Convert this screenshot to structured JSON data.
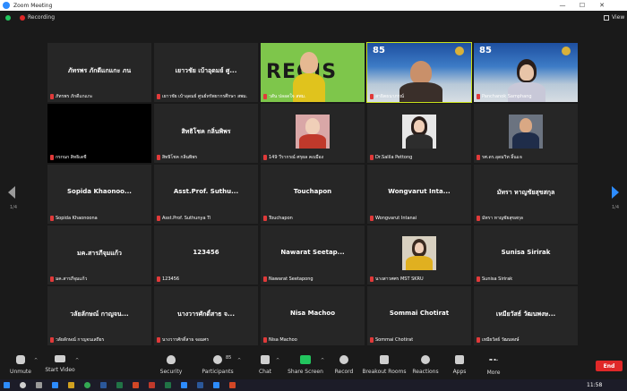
{
  "window": {
    "title": "Zoom Meeting",
    "controls": [
      "—",
      "☐",
      "✕"
    ]
  },
  "status": {
    "recording_label": "Recording",
    "view_label": "View"
  },
  "pages": {
    "left": "1/4",
    "right": "1/4"
  },
  "tiles": [
    {
      "big": "ภัทรพร ภักดีแกแกะ ภน",
      "name": "ภัทรพร ภักดีแกแกะ"
    },
    {
      "big": "เยาวชัย เบ้าอุดมย์ ศู...",
      "name": "เยาวชัย เบ้าอุดมย์ ศูนย์ทรัพยากรศึกษา สพม."
    },
    {
      "big": "",
      "name": "วสัน ปลอดใจ สพม.",
      "video": "regis",
      "video_text": "REGIS"
    },
    {
      "big": "",
      "name": "สาธิตธนาภรณ์",
      "video": "man",
      "video_text": "85"
    },
    {
      "big": "",
      "name": "Panchanok Samphang",
      "video": "woman",
      "video_text": "85"
    },
    {
      "big": "",
      "name": "กรกนก สิทธิเดชี",
      "video": "black"
    },
    {
      "big": "สิทธิโชค กลิ่นพิพร",
      "name": "สิทธิโชค กลิ่นพิพร"
    },
    {
      "big": "",
      "name": "149 วีรากรณ์ ศรุผล คงเมือง",
      "video": "photo"
    },
    {
      "big": "",
      "name": "Dr.Salila Pettong",
      "video": "photo"
    },
    {
      "big": "",
      "name": "รศ.ดร.อุดมวิท อิ้นแจ",
      "video": "photo"
    },
    {
      "big": "Sopida Khaonoo...",
      "name": "Sopida Khaonoona"
    },
    {
      "big": "Asst.Prof. Suthu...",
      "name": "Asst.Prof. Suthunya Ti"
    },
    {
      "big": "Touchapon",
      "name": "Touchapon"
    },
    {
      "big": "Wongvarut Inta...",
      "name": "Wongvarut Intanai"
    },
    {
      "big": "มัทรา หาญชัยสุขสกุล",
      "name": "มัทรา หาญชัยสุขสกุล"
    },
    {
      "big": "มค.สารภีจุมแก้ว",
      "name": "มค.สารภีจุมแก้ว"
    },
    {
      "big": "123456",
      "name": "123456"
    },
    {
      "big": "Nawarat Seetap...",
      "name": "Nawarat Seetapong"
    },
    {
      "big": "",
      "name": "นางสาวศศร MST SKRU",
      "video": "photo"
    },
    {
      "big": "Sunisa Sirirak",
      "name": "Sunisa Sirirak"
    },
    {
      "big": "วลัยลักษณ์ กาญจน...",
      "name": "วลัยลักษณ์ กาญจนเสถียร"
    },
    {
      "big": "นางวารศักดิ์สาธ จ...",
      "name": "นางวารศักดิ์สาธ จอมศร"
    },
    {
      "big": "Nisa Machoo",
      "name": "Nisa Machoo"
    },
    {
      "big": "Sommai Chotirat",
      "name": "Sommai Chotirat"
    },
    {
      "big": "เหมียวัสธ์ วัฒนพงษ...",
      "name": "เหมียวัสธ์ วัฒนพงษ์"
    }
  ],
  "toolbar": {
    "unmute": "Unmute",
    "start_video": "Start Video",
    "security": "Security",
    "participants": "Participants",
    "participants_count": "85",
    "chat": "Chat",
    "share_screen": "Share Screen",
    "record": "Record",
    "breakout": "Breakout Rooms",
    "reactions": "Reactions",
    "apps": "Apps",
    "more": "More",
    "end": "End"
  },
  "taskbar": {
    "clock": "11:58"
  },
  "colors": {
    "accent": "#2d8cff",
    "end": "#e02828",
    "share": "#22c55e",
    "active_speaker": "#c9e11b"
  }
}
